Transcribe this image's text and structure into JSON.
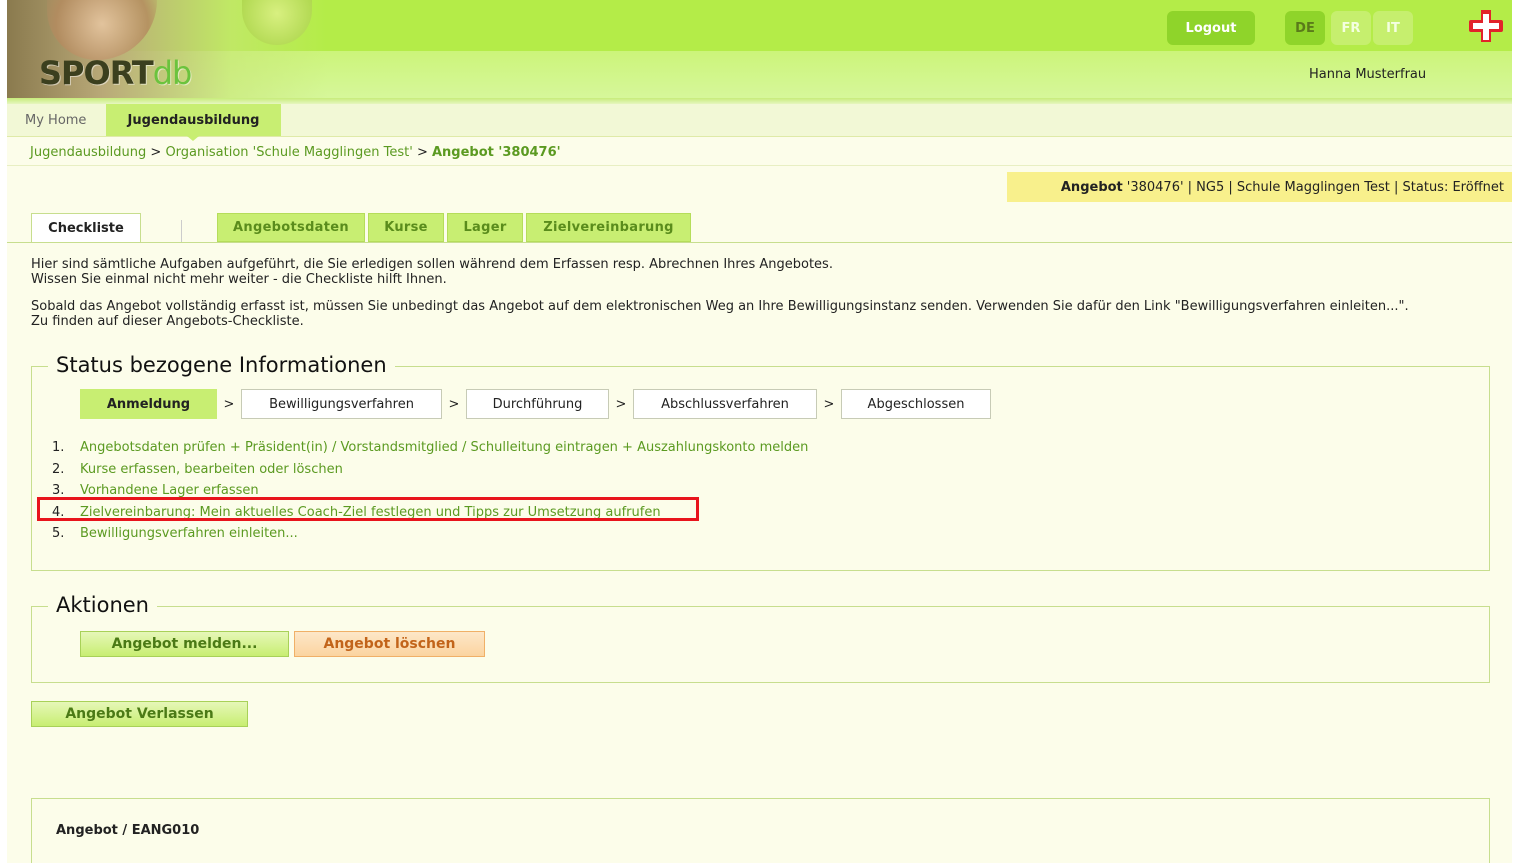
{
  "app": {
    "logo_main": "SPORT",
    "logo_sub": "db"
  },
  "header": {
    "logout_label": "Logout",
    "languages": [
      "DE",
      "FR",
      "IT"
    ],
    "active_language": "DE",
    "user_name": "Hanna Musterfrau",
    "accent_color": "#8fd42a"
  },
  "nav": {
    "home_label": "My Home",
    "active_label": "Jugendausbildung"
  },
  "breadcrumb": {
    "item1": "Jugendausbildung",
    "sep": ">",
    "item2": "Organisation 'Schule Magglingen Test'",
    "current": "Angebot '380476'"
  },
  "infobar": {
    "label": "Angebot",
    "text": "'380476' | NG5 | Schule Magglingen Test | Status: Eröffnet"
  },
  "tabs": {
    "active": "Checkliste",
    "items": [
      "Angebotsdaten",
      "Kurse",
      "Lager",
      "Zielvereinbarung"
    ]
  },
  "intro": {
    "line1": "Hier sind sämtliche Aufgaben aufgeführt, die Sie erledigen sollen während dem Erfassen resp. Abrechnen Ihres Angebotes.",
    "line2": "Wissen Sie einmal nicht mehr weiter - die Checkliste hilft Ihnen.",
    "line3": "Sobald das Angebot vollständig erfasst ist, müssen Sie unbedingt das Angebot auf dem elektronischen Weg an Ihre Bewilligungsinstanz senden. Verwenden Sie dafür den Link \"Bewilligungsverfahren einleiten...\".",
    "line4": "Zu finden auf dieser Angebots-Checkliste."
  },
  "status_section": {
    "title": "Status bezogene Informationen",
    "steps": [
      "Anmeldung",
      "Bewilligungsverfahren",
      "Durchführung",
      "Abschlussverfahren",
      "Abgeschlossen"
    ],
    "step_separator": ">",
    "active_step": "Anmeldung",
    "tasks": [
      {
        "num": "1.",
        "label": "Angebotsdaten prüfen + Präsident(in) / Vorstandsmitglied / Schulleitung eintragen + Auszahlungskonto melden"
      },
      {
        "num": "2.",
        "label": "Kurse erfassen, bearbeiten oder löschen"
      },
      {
        "num": "3.",
        "label": "Vorhandene Lager erfassen"
      },
      {
        "num": "4.",
        "label": "Zielvereinbarung: Mein aktuelles Coach-Ziel festlegen und Tipps zur Umsetzung aufrufen"
      },
      {
        "num": "5.",
        "label": "Bewilligungsverfahren einleiten..."
      }
    ],
    "highlighted_task": "4.",
    "highlight_color": "#e8141c"
  },
  "actions": {
    "title": "Aktionen",
    "melden_label": "Angebot melden...",
    "loeschen_label": "Angebot löschen"
  },
  "leave_button_label": "Angebot Verlassen",
  "footer_box": {
    "label": "Angebot / EANG010"
  }
}
